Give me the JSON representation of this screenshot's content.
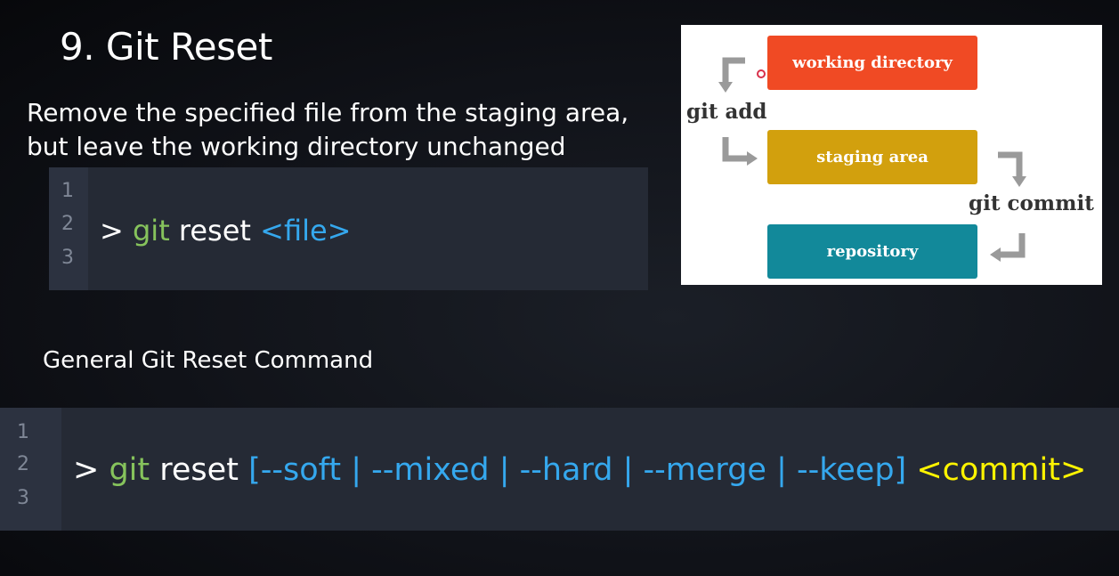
{
  "slide": {
    "title": "9. Git Reset",
    "description_line1": "Remove the specified file from the staging area,",
    "description_line2": "but leave the working directory unchanged",
    "subtitle": "General Git Reset Command"
  },
  "code_block_1": {
    "line_numbers": [
      "1",
      "2",
      "3"
    ],
    "prompt": ">",
    "git": "git",
    "command": "reset",
    "argument": "<file>"
  },
  "code_block_2": {
    "line_numbers": [
      "1",
      "2",
      "3"
    ],
    "prompt": ">",
    "git": "git",
    "command": "reset",
    "options": "[--soft | --mixed | --hard | --merge | --keep]",
    "argument": "<commit>"
  },
  "diagram": {
    "boxes": [
      {
        "label": "working directory",
        "color": "#f04a24"
      },
      {
        "label": "staging area",
        "color": "#d2a00d"
      },
      {
        "label": "repository",
        "color": "#12899a"
      }
    ],
    "labels": {
      "git_add": "git add",
      "git_commit": "git commit"
    }
  },
  "colors": {
    "git_keyword": "#86c35c",
    "option_text": "#35a8ee",
    "argument_text": "#fff400",
    "code_background": "#252a35"
  }
}
